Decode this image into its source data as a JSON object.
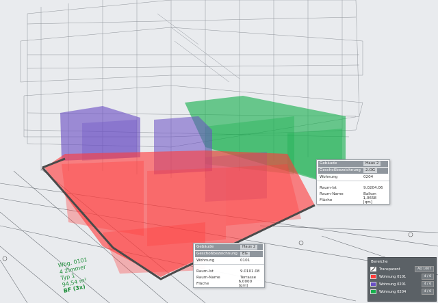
{
  "colors": {
    "background": "#e9ebee",
    "wireframe": "#7f848a",
    "red_volume": "#ff3b3b",
    "blue_volume": "#6a4fc4",
    "green_volume": "#17b04d",
    "floor_outline": "#4a4a4a",
    "label_green": "#1e8f3a"
  },
  "info_top": {
    "gebaeude_key": "Gebäude",
    "gebaeude_val": "Haus 2",
    "geschoss_key": "Geschoßbezeichnung",
    "geschoss_val": "2.OG",
    "wohnung_key": "Wohnung",
    "wohnung_val": "0204",
    "raum_ist_key": "Raum-Ist",
    "raum_ist_val": "9.0204.06",
    "raum_name_key": "Raum-Name",
    "raum_name_val": "Balkon",
    "flaeche_key": "Fläche",
    "flaeche_val": "1,0658 [qm]"
  },
  "info_bottom": {
    "gebaeude_key": "Gebäude",
    "gebaeude_val": "Haus 2",
    "geschoss_key": "Geschoßbezeichnung",
    "geschoss_val": "EG",
    "wohnung_key": "Wohnung",
    "wohnung_val": "0101",
    "raum_ist_key": "Raum-Ist",
    "raum_ist_val": "9.0101.08",
    "raum_name_key": "Raum-Name",
    "raum_name_val": "Terrasse",
    "flaeche_key": "Fläche",
    "flaeche_val": "6,0000 [qm]"
  },
  "legend": {
    "title": "Bereiche",
    "items": [
      {
        "label": "Transparent",
        "pct": "AD 1007",
        "color": "#ffffff"
      },
      {
        "label": "Wohnung 0101",
        "pct": "4 / 6",
        "color": "#ff3b3b"
      },
      {
        "label": "Wohnung 0201",
        "pct": "4 / 6",
        "color": "#6a4fc4"
      },
      {
        "label": "Wohnung 0204",
        "pct": "4 / 6",
        "color": "#17b04d"
      }
    ]
  },
  "apartment_label": {
    "line1": "Wbg. 0101",
    "line2": "4 Zimmer",
    "line3": "Typ 1",
    "line4": "94,54 m²",
    "line5": "BF (3x)"
  }
}
